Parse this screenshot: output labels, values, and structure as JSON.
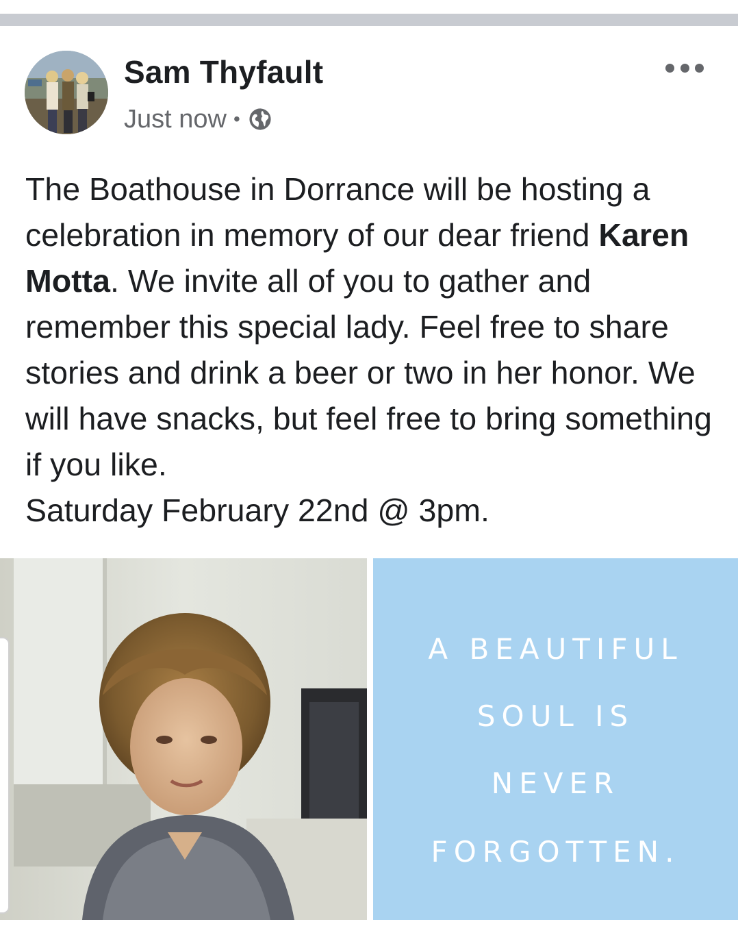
{
  "post": {
    "author": "Sam Thyfault",
    "timestamp": "Just now",
    "separator": "•",
    "privacy_icon": "globe-icon",
    "more_icon": "more-options-icon",
    "text_before": "The Boathouse in Dorrance will be hosting a celebration in memory of our dear friend ",
    "mention": "Karen Motta",
    "text_after": ". We invite all of you to gather and remember this special lady. Feel free to share stories and drink a beer or two in her honor. We will have snacks, but feel free to bring something if you like.",
    "event_line": "Saturday February 22nd @ 3pm."
  },
  "quote_image": {
    "line1": "A BEAUTIFUL",
    "line2": "SOUL IS",
    "line3": "NEVER",
    "line4": "FORGOTTEN."
  },
  "colors": {
    "primary_text": "#1c1e21",
    "secondary_text": "#65676b",
    "quote_background": "#a9d3f1",
    "divider": "#c8cbd1"
  }
}
